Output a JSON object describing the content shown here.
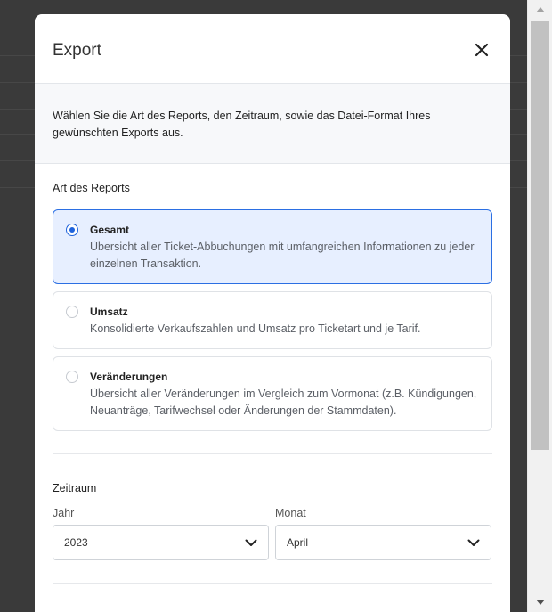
{
  "modal": {
    "title": "Export",
    "intro": "Wählen Sie die Art des Reports, den Zeitraum, sowie das Datei-Format Ihres gewünschten Exports aus."
  },
  "report_type": {
    "heading": "Art des Reports",
    "options": [
      {
        "title": "Gesamt",
        "description": "Übersicht aller Ticket-Abbuchungen mit umfangreichen Informationen zu jeder einzelnen Transaktion.",
        "selected": true
      },
      {
        "title": "Umsatz",
        "description": "Konsolidierte Verkaufszahlen und Umsatz pro Ticketart und je Tarif.",
        "selected": false
      },
      {
        "title": "Veränderungen",
        "description": "Übersicht aller Veränderungen im Vergleich zum Vormonat (z.B. Kündigungen, Neuanträge, Tarifwechsel oder Änderungen der Stammdaten).",
        "selected": false
      }
    ]
  },
  "period": {
    "heading": "Zeitraum",
    "year_label": "Jahr",
    "year_value": "2023",
    "month_label": "Monat",
    "month_value": "April"
  },
  "colors": {
    "accent": "#1f63dc",
    "selected_bg": "#e7efff",
    "overlay": "#3a3a3a"
  },
  "icons": {
    "close": "close-icon",
    "select_chevron": "chevron-down-icon",
    "scroll_up": "scroll-up-arrow-icon",
    "scroll_down": "scroll-down-arrow-icon"
  }
}
